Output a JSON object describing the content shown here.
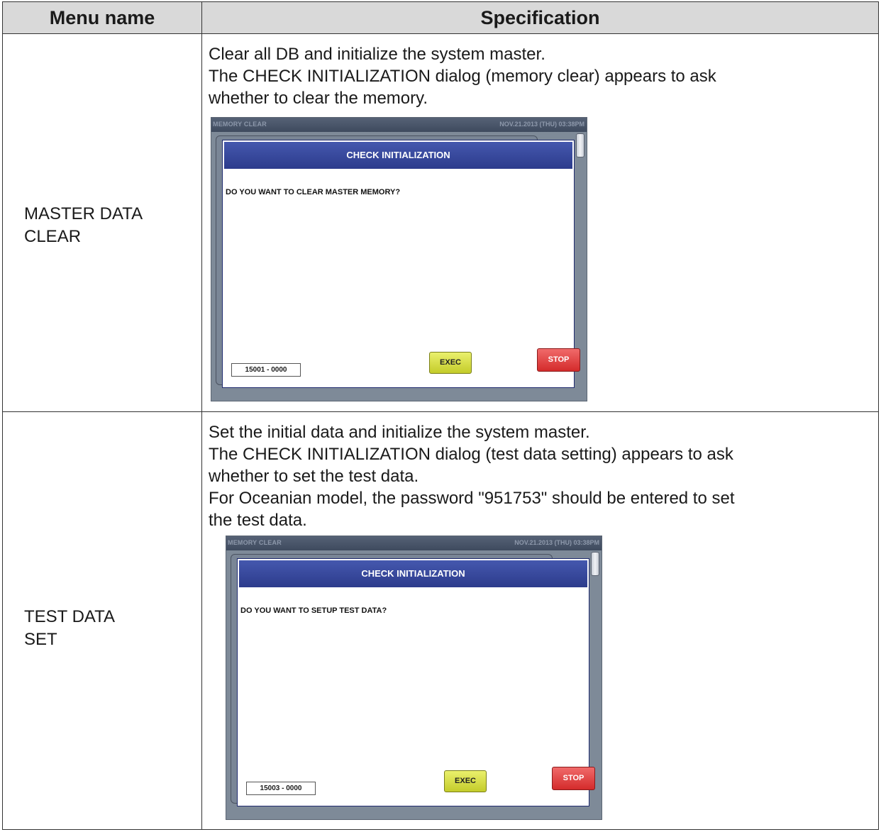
{
  "table": {
    "headers": {
      "menu_name": "Menu name",
      "specification": "Specification"
    },
    "rows": [
      {
        "menu_name": "MASTER DATA\nCLEAR",
        "spec_lines": [
          "Clear all DB and initialize the system master.",
          "The CHECK INITIALIZATION dialog (memory clear) appears to ask",
          "whether to clear the memory."
        ],
        "screen": {
          "title": "MEMORY CLEAR",
          "datetime": "NOV.21.2013 (THU)  03:38PM",
          "dialog_title": "CHECK INITIALIZATION",
          "question": "DO YOU WANT TO CLEAR MASTER MEMORY?",
          "code": "15001 - 0000",
          "exec_label": "EXEC",
          "stop_label": "STOP"
        }
      },
      {
        "menu_name": "TEST DATA\nSET",
        "spec_lines": [
          "Set the initial data and initialize the system master.",
          "The CHECK INITIALIZATION dialog (test data setting) appears to ask",
          "whether to set the test data.",
          "For Oceanian model, the password \"951753\" should be entered to set",
          "the test data."
        ],
        "screen": {
          "title": "MEMORY CLEAR",
          "datetime": "NOV.21.2013 (THU)  03:38PM",
          "dialog_title": "CHECK INITIALIZATION",
          "question": "DO YOU WANT TO SETUP TEST DATA?",
          "code": "15003 - 0000",
          "exec_label": "EXEC",
          "stop_label": "STOP"
        }
      }
    ]
  },
  "colors": {
    "header_bg": "#d9d9d9",
    "dialog_header": "#2c3b8c",
    "exec_button": "#d4dc3a",
    "stop_button": "#e03a3a",
    "screen_bg": "#7e8a98"
  }
}
